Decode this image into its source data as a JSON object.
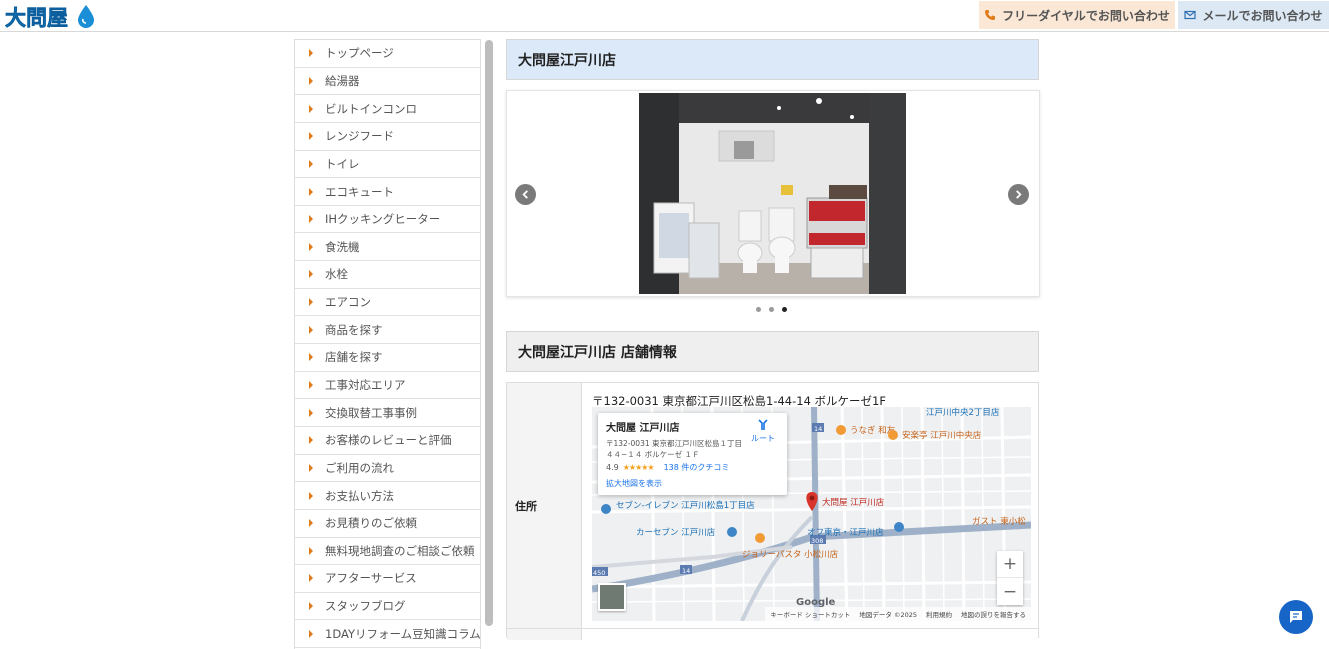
{
  "header": {
    "logo_text": "大問屋",
    "tel_label": "フリーダイヤルでお問い合わせ",
    "mail_label": "メールでお問い合わせ"
  },
  "sidebar": {
    "items": [
      {
        "label": "トップページ"
      },
      {
        "label": "給湯器"
      },
      {
        "label": "ビルトインコンロ"
      },
      {
        "label": "レンジフード"
      },
      {
        "label": "トイレ"
      },
      {
        "label": "エコキュート"
      },
      {
        "label": "IHクッキングヒーター"
      },
      {
        "label": "食洗機"
      },
      {
        "label": "水栓"
      },
      {
        "label": "エアコン"
      },
      {
        "label": "商品を探す"
      },
      {
        "label": "店舗を探す"
      },
      {
        "label": "工事対応エリア"
      },
      {
        "label": "交換取替工事事例"
      },
      {
        "label": "お客様のレビューと評価"
      },
      {
        "label": "ご利用の流れ"
      },
      {
        "label": "お支払い方法"
      },
      {
        "label": "お見積りのご依頼"
      },
      {
        "label": "無料現地調査のご相談ご依頼"
      },
      {
        "label": "アフターサービス"
      },
      {
        "label": "スタッフブログ"
      },
      {
        "label": "1DAYリフォーム豆知識コラム"
      }
    ]
  },
  "main": {
    "page_title": "大問屋江戸川店",
    "slider": {
      "dot_count": 3,
      "active_index": 2
    },
    "info_title": "大問屋江戸川店 店舗情報",
    "address_label": "住所",
    "address_value": "〒132-0031 東京都江戸川区松島1-44-14 ボルケーゼ1F"
  },
  "map": {
    "card_name": "大問屋 江戸川店",
    "card_address": "〒132-0031 東京都江戸川区松島１丁目４４−１４ ボルケーゼ １Ｆ",
    "rating": "4.9",
    "stars": "★★★★★",
    "reviews": "138 件のクチコミ",
    "enlarge_link": "拡大地図を表示",
    "route_label": "ルート",
    "pin_label": "大問屋 江戸川店",
    "place_labels": [
      "うなぎ 和友",
      "安楽亭 江戸川中央店",
      "江戸川中央2丁目店",
      "セブン-イレブン 江戸川松島1丁目店",
      "カーセブン 江戸川店",
      "ジョリーパスタ 小松川店",
      "オフ東京・江戸川店",
      "ガスト 東小松"
    ],
    "road_numbers": [
      "14",
      "14",
      "308",
      "450"
    ],
    "google_label": "Google",
    "footer": [
      "キーボード ショートカット",
      "地図データ ©2025",
      "利用規約",
      "地図の誤りを報告する"
    ],
    "zoom_in": "+",
    "zoom_out": "−"
  },
  "colors": {
    "accent_orange": "#e07b1c",
    "title_blue_bg": "#dbe9f8",
    "tel_bg": "#fbe7d6",
    "mail_bg": "#dce9f5",
    "chat_blue": "#1765c6",
    "logo_blue": "#1a8fd8"
  }
}
